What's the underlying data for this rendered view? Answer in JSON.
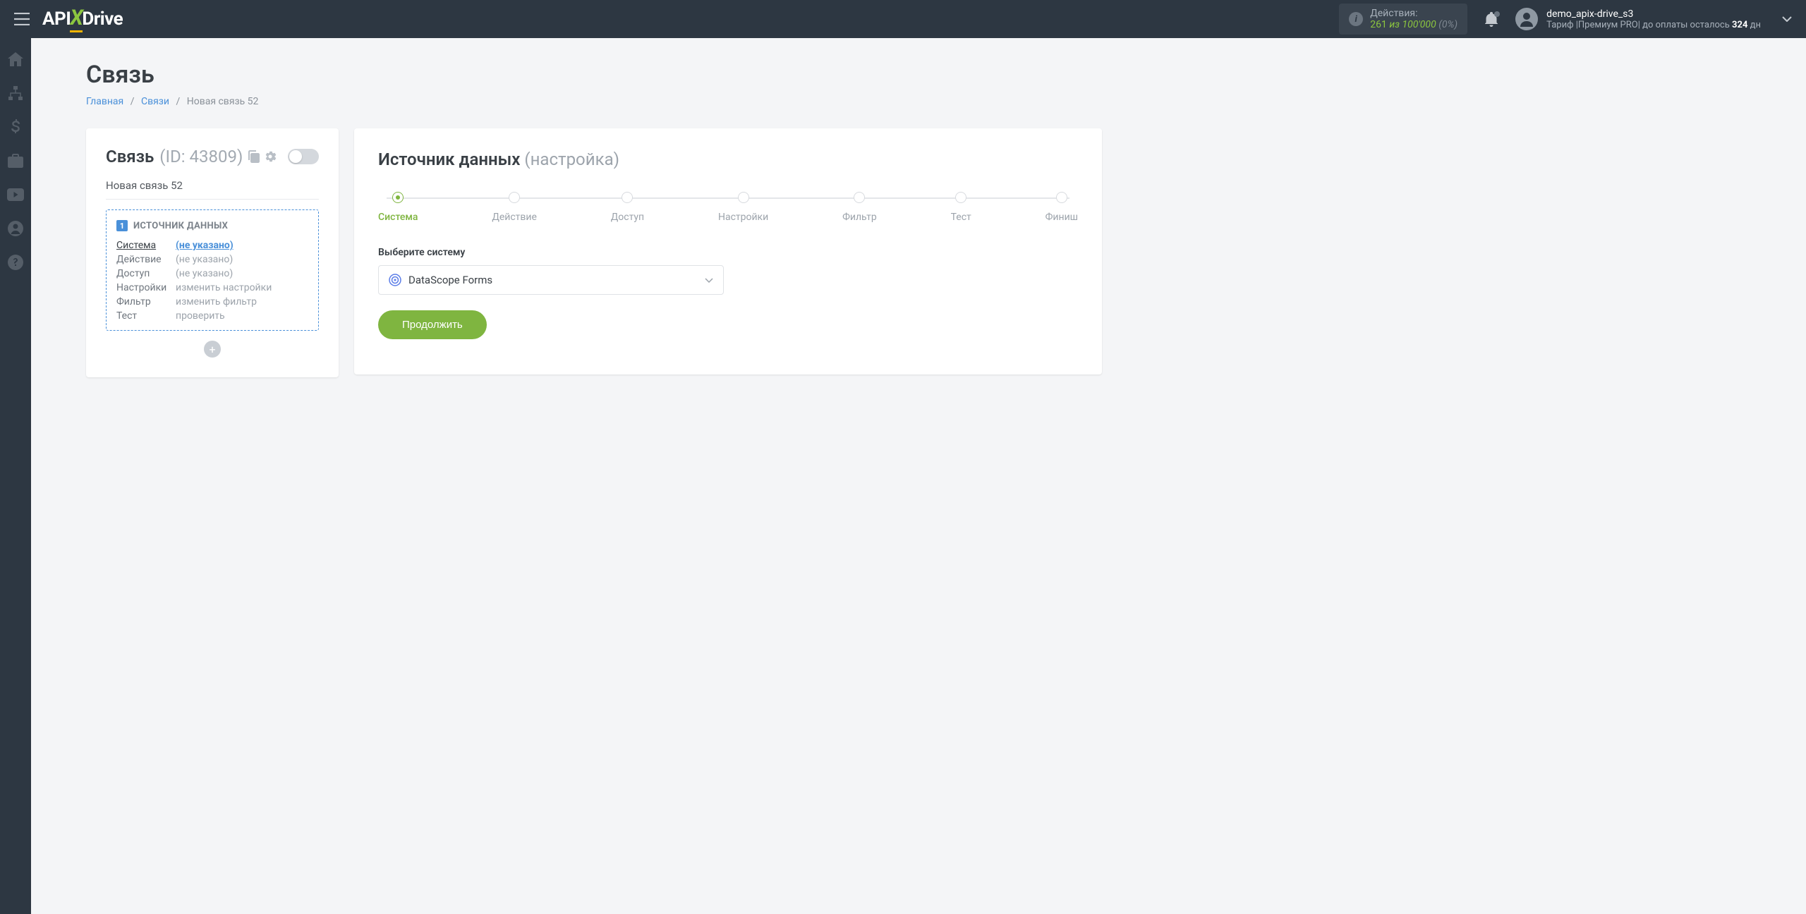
{
  "header": {
    "logo": {
      "api": "API",
      "x": "X",
      "drive": "Drive"
    },
    "actions": {
      "label": "Действия:",
      "count": "261",
      "of": "из",
      "max": "100'000",
      "pct": "(0%)"
    },
    "user": {
      "name": "demo_apix-drive_s3",
      "plan_prefix": "Тариф |",
      "plan_name": "Премиум PRO",
      "plan_mid": "| до оплаты осталось ",
      "days": "324",
      "days_suffix": " дн"
    }
  },
  "page": {
    "title": "Связь",
    "breadcrumb": {
      "home": "Главная",
      "links": "Связи",
      "current": "Новая связь 52"
    }
  },
  "left": {
    "title": "Связь",
    "id": "(ID: 43809)",
    "name": "Новая связь 52",
    "box_title": "ИСТОЧНИК ДАННЫХ",
    "rows": [
      {
        "label": "Система",
        "value": "(не указано)",
        "active": true,
        "link": true
      },
      {
        "label": "Действие",
        "value": "(не указано)"
      },
      {
        "label": "Доступ",
        "value": "(не указано)"
      },
      {
        "label": "Настройки",
        "value": "изменить настройки"
      },
      {
        "label": "Фильтр",
        "value": "изменить фильтр"
      },
      {
        "label": "Тест",
        "value": "проверить"
      }
    ]
  },
  "right": {
    "title_main": "Источник данных",
    "title_sub": "(настройка)",
    "steps": [
      "Система",
      "Действие",
      "Доступ",
      "Настройки",
      "Фильтр",
      "Тест",
      "Финиш"
    ],
    "active_step": 0,
    "field_label": "Выберите систему",
    "selected_system": "DataScope Forms",
    "continue": "Продолжить"
  },
  "icons": {
    "sidebar": [
      "home",
      "sitemap",
      "dollar",
      "briefcase",
      "youtube",
      "user-circle",
      "question"
    ]
  }
}
